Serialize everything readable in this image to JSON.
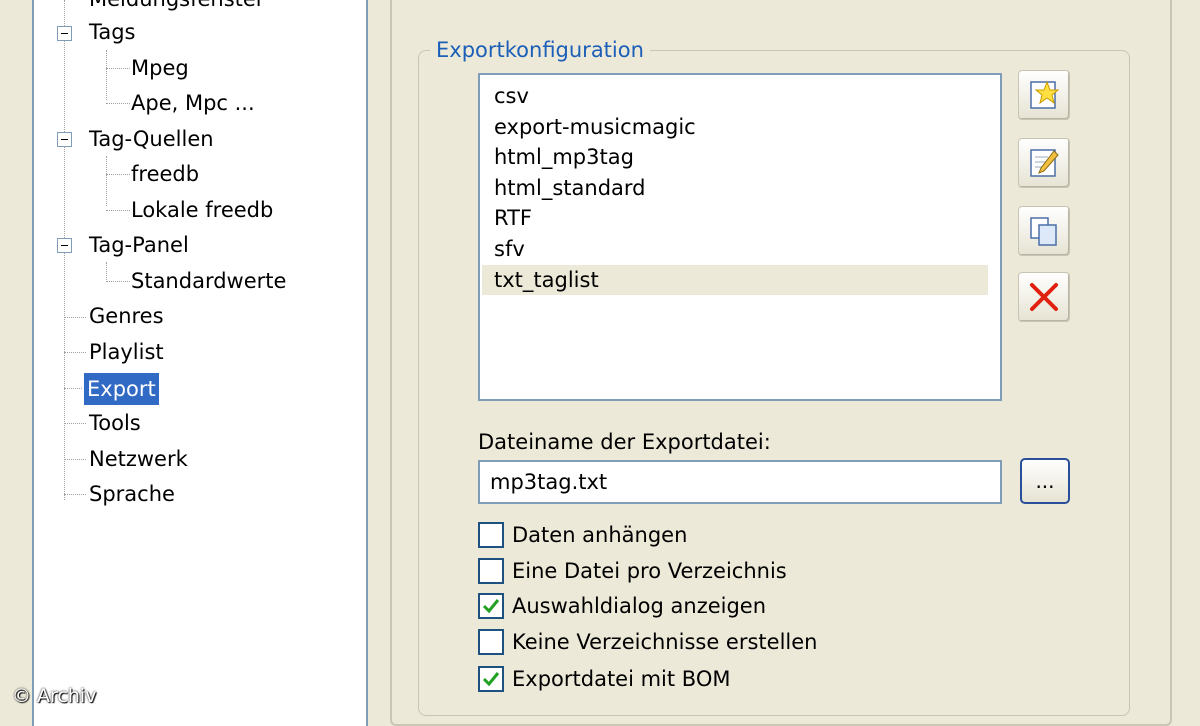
{
  "tree": {
    "items": [
      {
        "label": "Meldungsfenster"
      },
      {
        "label": "Tags"
      },
      {
        "label": "Mpeg"
      },
      {
        "label": "Ape, Mpc ..."
      },
      {
        "label": "Tag-Quellen"
      },
      {
        "label": "freedb"
      },
      {
        "label": "Lokale freedb"
      },
      {
        "label": "Tag-Panel"
      },
      {
        "label": "Standardwerte"
      },
      {
        "label": "Genres"
      },
      {
        "label": "Playlist"
      },
      {
        "label": "Export"
      },
      {
        "label": "Tools"
      },
      {
        "label": "Netzwerk"
      },
      {
        "label": "Sprache"
      }
    ],
    "selected": "Export"
  },
  "export_config": {
    "title": "Exportkonfiguration",
    "list": [
      "csv",
      "export-musicmagic",
      "html_mp3tag",
      "html_standard",
      "RTF",
      "sfv",
      "txt_taglist"
    ],
    "selected": "txt_taglist",
    "buttons": {
      "new_icon": "star-new-icon",
      "edit_icon": "edit-icon",
      "copy_icon": "copy-icon",
      "delete_icon": "delete-x-icon"
    },
    "filename_label": "Dateiname der Exportdatei:",
    "filename_value": "mp3tag.txt",
    "browse_label": "...",
    "options": [
      {
        "label": "Daten anhängen",
        "checked": false
      },
      {
        "label": "Eine Datei pro Verzeichnis",
        "checked": false
      },
      {
        "label": "Auswahldialog anzeigen",
        "checked": true
      },
      {
        "label": "Keine Verzeichnisse erstellen",
        "checked": false
      },
      {
        "label": "Exportdatei mit BOM",
        "checked": true
      }
    ]
  },
  "watermark": "© Archiv",
  "colors": {
    "selection": "#316ac5",
    "group_title": "#1c5fb8",
    "check": "#21a121",
    "delete": "#e02010"
  }
}
